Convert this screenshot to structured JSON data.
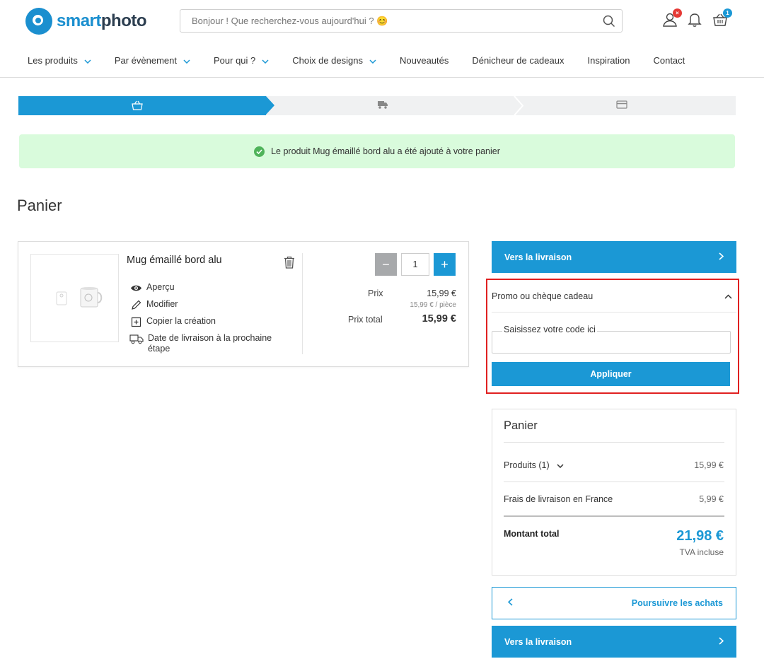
{
  "header": {
    "search_placeholder": "Bonjour ! Que recherchez-vous aujourd'hui ? 😊",
    "user_badge": "×",
    "cart_badge": "1"
  },
  "nav": {
    "items": [
      {
        "label": "Les produits",
        "dropdown": true
      },
      {
        "label": "Par évènement",
        "dropdown": true
      },
      {
        "label": "Pour qui ?",
        "dropdown": true
      },
      {
        "label": "Choix de designs",
        "dropdown": true
      },
      {
        "label": "Nouveautés",
        "dropdown": false
      },
      {
        "label": "Dénicheur de cadeaux",
        "dropdown": false
      },
      {
        "label": "Inspiration",
        "dropdown": false
      },
      {
        "label": "Contact",
        "dropdown": false
      }
    ]
  },
  "alert": {
    "message": "Le produit Mug émaillé bord alu a été ajouté à votre panier"
  },
  "page": {
    "title": "Panier"
  },
  "cart_item": {
    "name": "Mug émaillé bord alu",
    "actions": [
      {
        "icon": "eye-icon",
        "label": "Aperçu"
      },
      {
        "icon": "pencil-icon",
        "label": "Modifier"
      },
      {
        "icon": "copy-icon",
        "label": "Copier la création"
      },
      {
        "icon": "delivery-truck-icon",
        "label": "Date de livraison à la prochaine étape"
      }
    ],
    "quantity": "1",
    "minus": "−",
    "plus": "+",
    "price_label": "Prix",
    "price": "15,99 €",
    "unit_price": "15,99 € / pièce",
    "total_label": "Prix total",
    "total": "15,99 €"
  },
  "checkout": {
    "to_delivery": "Vers la livraison",
    "continue_shopping": "Poursuivre les achats"
  },
  "promo": {
    "title": "Promo ou chèque cadeau",
    "input_label": "Saisissez votre code ici",
    "apply": "Appliquer"
  },
  "summary": {
    "title": "Panier",
    "products_label": "Produits (1)",
    "products_value": "15,99 €",
    "shipping_label": "Frais de livraison en France",
    "shipping_value": "5,99 €",
    "total_label": "Montant total",
    "total_value": "21,98 €",
    "tax_note": "TVA incluse"
  },
  "colors": {
    "primary": "#1b98d5",
    "brand": "#1b8fcf",
    "success_bg": "#d9fbdc",
    "highlight_border": "#e02020"
  }
}
